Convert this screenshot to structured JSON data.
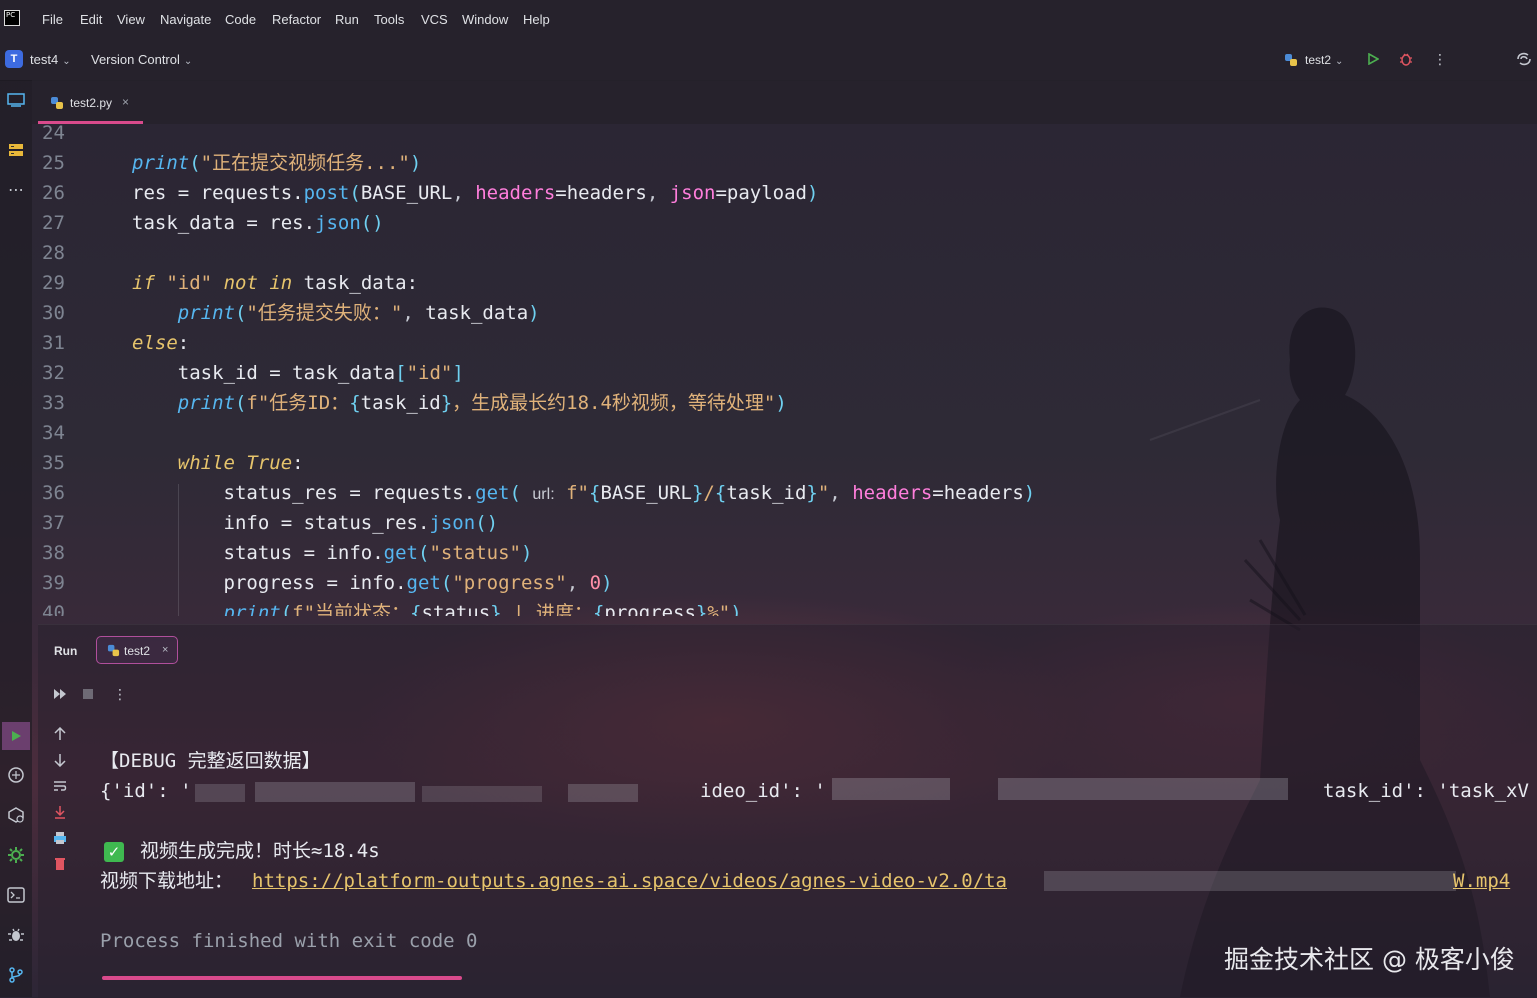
{
  "menu": {
    "items": [
      "File",
      "Edit",
      "View",
      "Navigate",
      "Code",
      "Refactor",
      "Run",
      "Tools",
      "VCS",
      "Window",
      "Help"
    ]
  },
  "toolbar": {
    "project_badge": "T",
    "project_name": "test4",
    "version_control": "Version Control",
    "run_config": "test2"
  },
  "editor": {
    "tab_label": "test2.py",
    "tab_close": "×"
  },
  "code": {
    "line_numbers": [
      "24",
      "25",
      "26",
      "27",
      "28",
      "29",
      "30",
      "31",
      "32",
      "33",
      "34",
      "35",
      "36",
      "37",
      "38",
      "39",
      "40"
    ],
    "hint_url": "url:"
  },
  "run": {
    "title": "Run",
    "tab_label": "test2",
    "tab_close": "×"
  },
  "console": {
    "debug_header": "【DEBUG 完整返回数据】",
    "json_start": "{'id': '",
    "json_video_id": "ideo_id': '",
    "json_task_id": "task_id': 'task_xV",
    "check_mark": "✓",
    "done_text": "视频生成完成！时长≈18.4s",
    "download_label": "视频下载地址：",
    "url_start": "https://platform-outputs.agnes-ai.space/videos/agnes-video-v2.0/ta",
    "url_end": "W.mp4",
    "exit_text": "Process finished with exit code 0"
  },
  "watermark": "掘金技术社区 @ 极客小俊",
  "colors": {
    "accent": "#d94a8c",
    "keyword": "#e6c46c",
    "function": "#56b6f0",
    "string": "#e0b27a",
    "param": "#ff7edc",
    "run_green": "#4caf50"
  }
}
